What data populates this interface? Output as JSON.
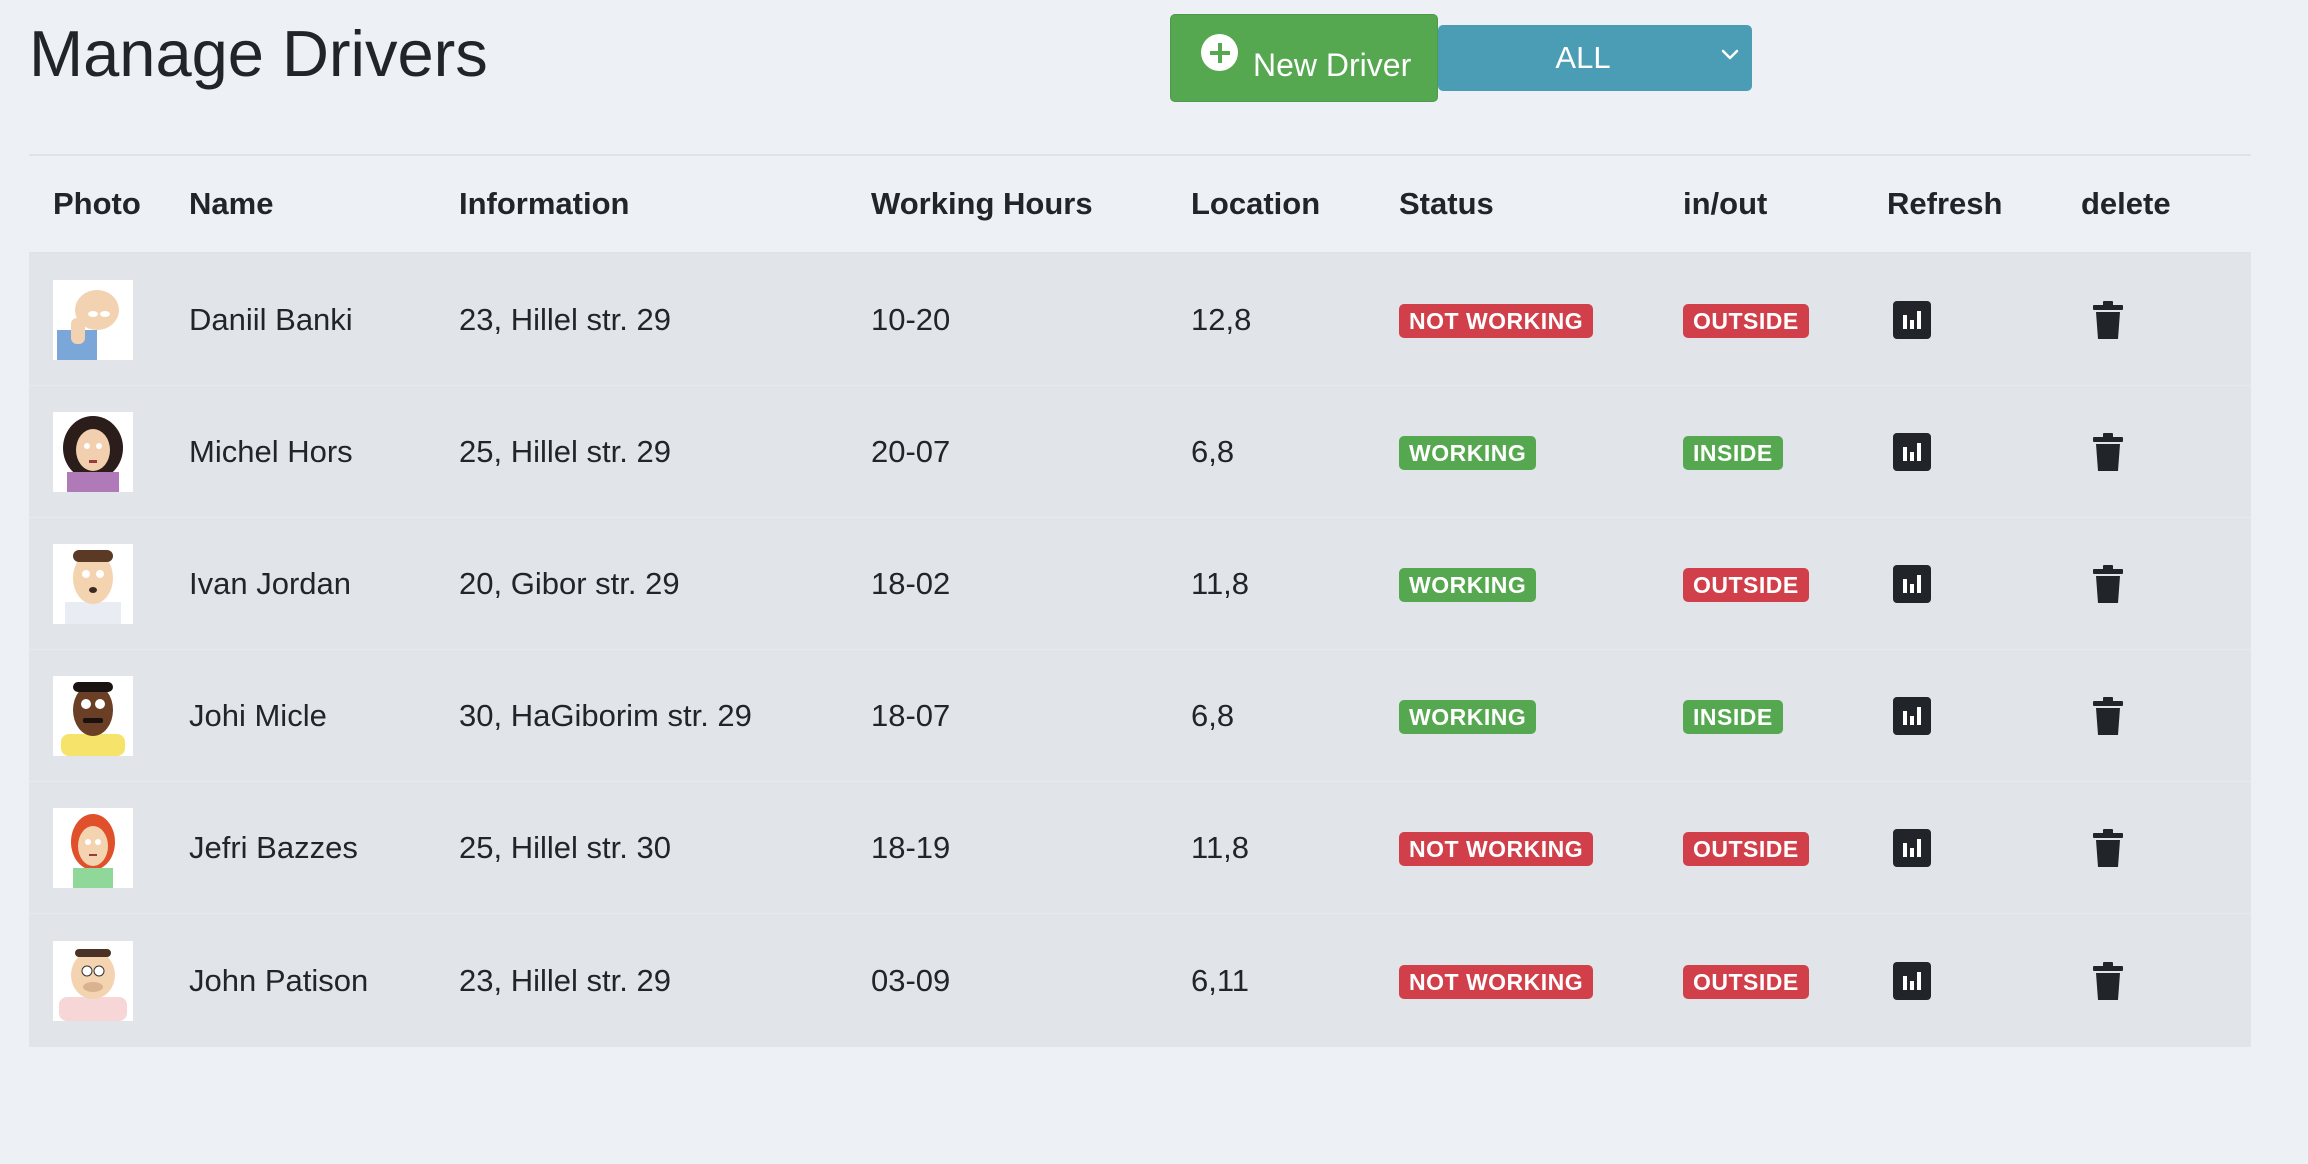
{
  "page": {
    "title": "Manage Drivers"
  },
  "toolbar": {
    "new_driver_label": "New Driver",
    "filter_value": "ALL"
  },
  "table": {
    "columns": [
      "Photo",
      "Name",
      "Information",
      "Working Hours",
      "Location",
      "Status",
      "in/out",
      "Refresh",
      "delete"
    ],
    "rows": [
      {
        "name": "Daniil Banki",
        "information": "23, Hillel str. 29",
        "working_hours": "10-20",
        "location": "12,8",
        "status": "NOT WORKING",
        "inout": "OUTSIDE"
      },
      {
        "name": "Michel Hors",
        "information": "25, Hillel str. 29",
        "working_hours": "20-07",
        "location": "6,8",
        "status": "WORKING",
        "inout": "INSIDE"
      },
      {
        "name": "Ivan Jordan",
        "information": "20, Gibor str. 29",
        "working_hours": "18-02",
        "location": "11,8",
        "status": "WORKING",
        "inout": "OUTSIDE"
      },
      {
        "name": "Johi Micle",
        "information": "30, HaGiborim str. 29",
        "working_hours": "18-07",
        "location": "6,8",
        "status": "WORKING",
        "inout": "INSIDE"
      },
      {
        "name": "Jefri Bazzes",
        "information": "25, Hillel str. 30",
        "working_hours": "18-19",
        "location": "11,8",
        "status": "NOT WORKING",
        "inout": "OUTSIDE"
      },
      {
        "name": "John Patison",
        "information": "23, Hillel str. 29",
        "working_hours": "03-09",
        "location": "6,11",
        "status": "NOT WORKING",
        "inout": "OUTSIDE"
      }
    ]
  },
  "colors": {
    "page_background": "#edf0f5",
    "new_driver_button": "#55a84f",
    "filter_select": "#4b9cb5",
    "badge_red": "#d1404a",
    "badge_green": "#55a84f",
    "row_background": "#e1e5e9"
  },
  "icons": {
    "new_driver": "plus-circle-icon",
    "filter": "chevron-down-icon",
    "refresh": "bar-chart-icon",
    "delete": "trash-icon",
    "photo": "avatar-cartoon"
  }
}
